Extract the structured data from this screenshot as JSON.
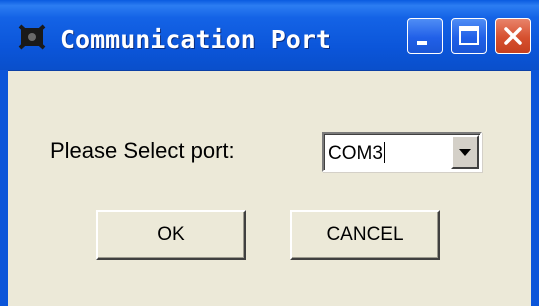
{
  "window": {
    "title": "Communication Port",
    "icon": "app-icon",
    "controls": [
      "minimize-icon",
      "maximize-icon",
      "close-icon"
    ]
  },
  "form": {
    "port_label": "Please Select port:",
    "port_value": "COM3"
  },
  "buttons": {
    "ok_label": "OK",
    "cancel_label": "CANCEL"
  },
  "colors": {
    "titlebar": "#0B55D9",
    "dialog_bg": "#ECE9D8",
    "close_button": "#D6502F"
  }
}
